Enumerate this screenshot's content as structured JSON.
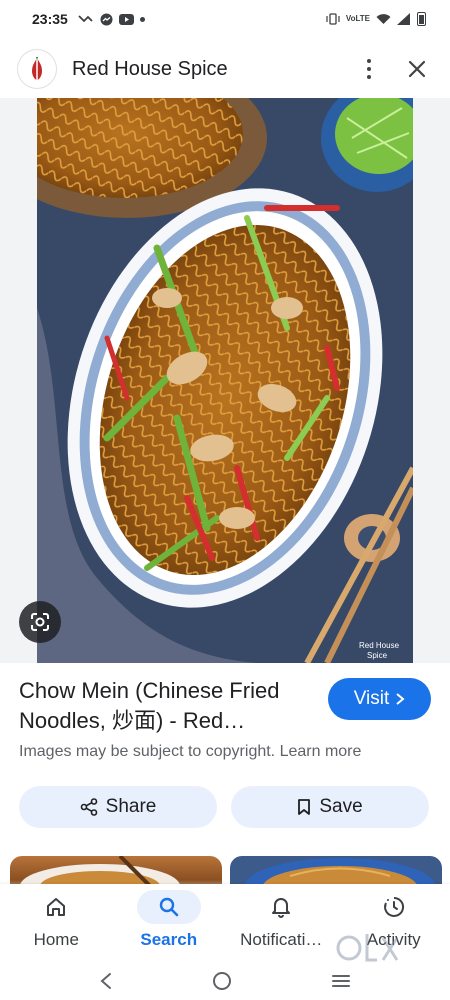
{
  "status_bar": {
    "time": "23:35",
    "network_label": "VoLTE",
    "lte_label": "LTE"
  },
  "header": {
    "site_name": "Red House Spice",
    "logo_icon": "chili-logo-icon",
    "menu_icon": "more-vert-icon",
    "close_icon": "close-icon"
  },
  "image": {
    "watermark_text": "Red House Spice",
    "lens_icon": "google-lens-icon"
  },
  "result": {
    "title": "Chow Mein (Chinese Fried Noodles, 炒面) - Red…",
    "visit_label": "Visit",
    "copyright_text": "Images may be subject to copyright. Learn more"
  },
  "actions": {
    "share_label": "Share",
    "save_label": "Save"
  },
  "bottom_nav": {
    "items": [
      {
        "label": "Home",
        "icon": "home-icon",
        "active": false
      },
      {
        "label": "Search",
        "icon": "search-icon",
        "active": true
      },
      {
        "label": "Notificati…",
        "icon": "bell-icon",
        "active": false
      },
      {
        "label": "Activity",
        "icon": "activity-icon",
        "active": false
      }
    ]
  },
  "colors": {
    "accent": "#1a73e8",
    "chip_bg": "#e8f0fe",
    "text_primary": "#202124",
    "text_secondary": "#5f6368"
  }
}
